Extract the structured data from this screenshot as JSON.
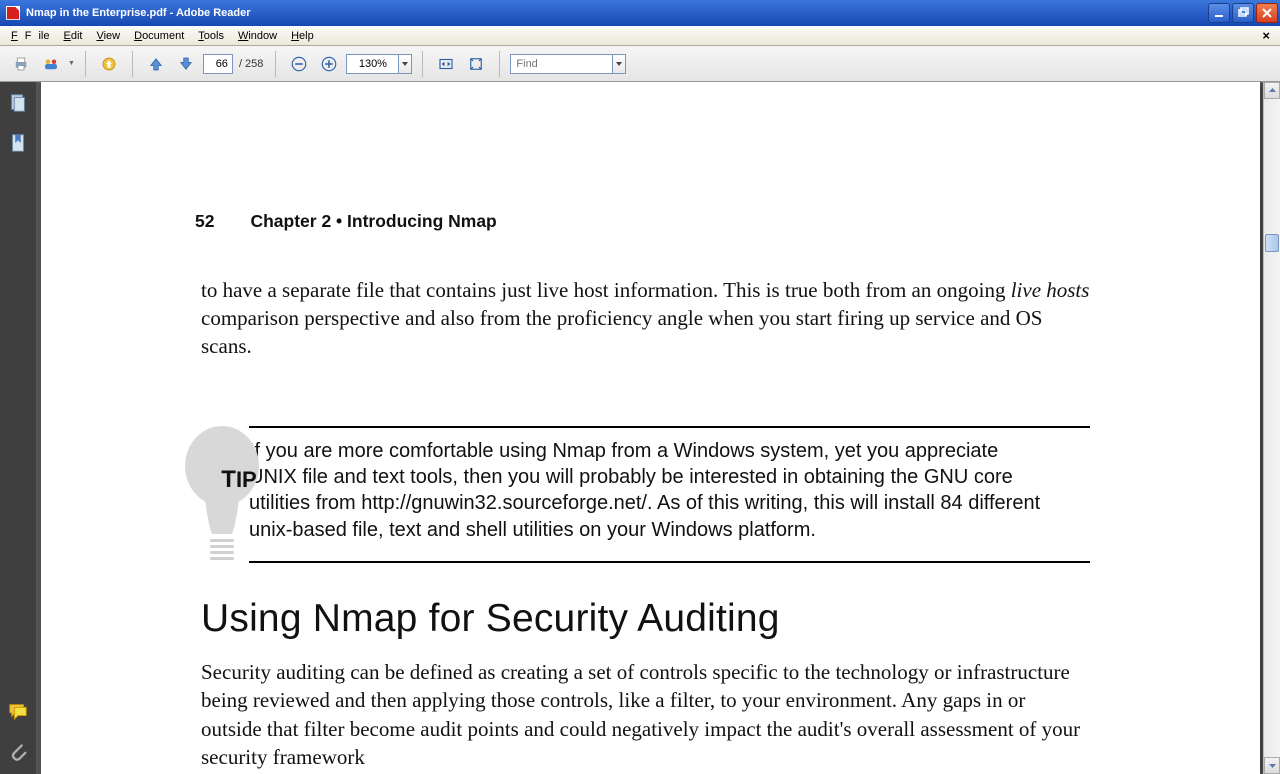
{
  "window": {
    "title": "Nmap in the Enterprise.pdf - Adobe Reader"
  },
  "menu": {
    "file": "File",
    "edit": "Edit",
    "view": "View",
    "document": "Document",
    "tools": "Tools",
    "window": "Window",
    "help": "Help",
    "close": "×"
  },
  "toolbar": {
    "page_current": "66",
    "page_total": "/ 258",
    "zoom": "130%",
    "find_placeholder": "Find"
  },
  "document": {
    "page_number": "52",
    "chapter_line": "Chapter 2 • Introducing Nmap",
    "para1_a": "to have a separate file that contains just live host information. This is true both from an ongoing ",
    "para1_em": "live hosts",
    "para1_b": " comparison perspective and also from the proficiency angle when you start firing up service and OS scans.",
    "tip_label_cap": "T",
    "tip_label_rest": "IP",
    "tip_body": "If you are more comfortable using Nmap from a Windows system, yet you appreciate UNIX file and text tools, then you will probably be interested in obtaining the GNU core utilities from http://gnuwin32.sourceforge.net/. As of this writing, this will install 84 different unix-based file, text and shell utilities on your Windows platform.",
    "section_heading": "Using Nmap for Security Auditing",
    "section_para": "Security auditing can be defined as creating a set of controls specific to the technology or infrastructure being reviewed and then applying those controls, like a filter, to your environment. Any gaps in or outside that filter become audit points and could negatively impact the audit's overall assessment of your security framework"
  }
}
